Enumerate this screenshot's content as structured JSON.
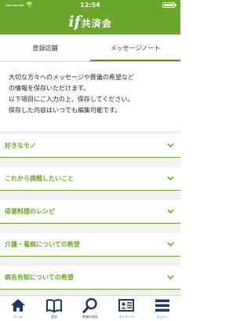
{
  "status_bar": {
    "carrier": "ーーー",
    "time": "12:54"
  },
  "header": {
    "logo_mark": "if",
    "logo_text": "共済会"
  },
  "tabs": [
    {
      "label": "登録店舗",
      "active": false
    },
    {
      "label": "メッセージノート",
      "active": true
    }
  ],
  "intro": {
    "lines": [
      "大切な方々へのメッセージや葬儀の希望など",
      "の情報を保存いただけます。",
      "以下項目にご入力の上、保存してください。",
      "保存した内容はいつでも編集可能です。"
    ]
  },
  "sections": [
    {
      "label": "好きなモノ"
    },
    {
      "label": "これから挑戦したいこと"
    },
    {
      "label": "得意料理のレシピ"
    },
    {
      "label": "介護・看病についての希望"
    },
    {
      "label": "病名告知についての希望"
    }
  ],
  "tabbar": [
    {
      "label": "ホーム",
      "icon": "home-icon"
    },
    {
      "label": "登録",
      "icon": "book-icon"
    },
    {
      "label": "葬儀社検索",
      "icon": "search-icon"
    },
    {
      "label": "マイページ",
      "icon": "profile-card-icon"
    },
    {
      "label": "メニュー",
      "icon": "menu-icon"
    }
  ],
  "colors": {
    "brand_green": "#6aa62a",
    "icon_navy": "#1a3a6b"
  }
}
